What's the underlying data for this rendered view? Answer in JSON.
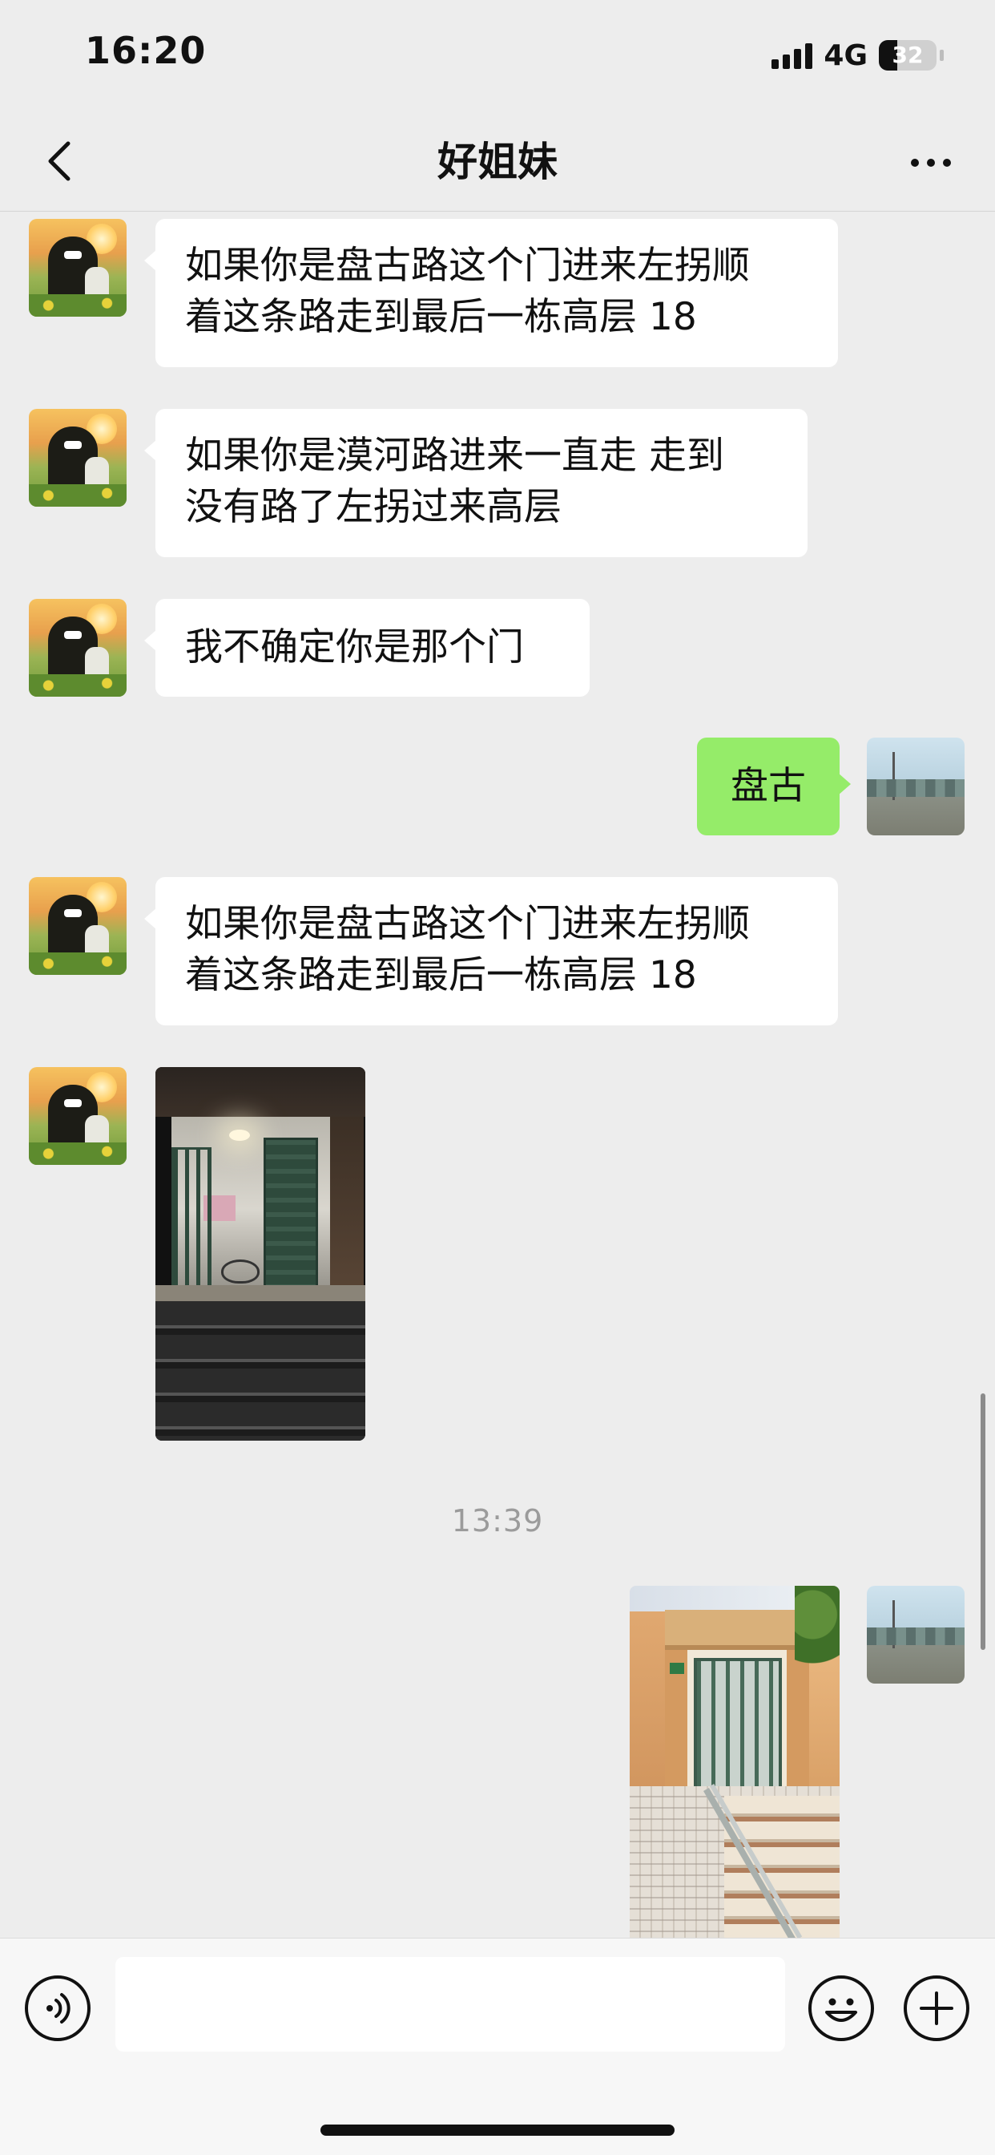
{
  "status_bar": {
    "time": "16:20",
    "network": "4G",
    "battery": "32",
    "battery_level": 0.32
  },
  "header": {
    "title": "好姐妹",
    "back_icon": "chevron-left-icon",
    "more_icon": "more-icon"
  },
  "messages": [
    {
      "side": "in",
      "type": "text",
      "lines": [
        "如果你是盘古路这个门进来左拐顺",
        "着这条路走到最后一栋高层 18"
      ]
    },
    {
      "side": "in",
      "type": "text",
      "lines": [
        "如果你是漠河路进来一直走 走到",
        "没有路了左拐过来高层"
      ]
    },
    {
      "side": "in",
      "type": "text",
      "lines": [
        "我不确定你是那个门"
      ]
    },
    {
      "side": "out",
      "type": "text",
      "lines": [
        "盘古"
      ]
    },
    {
      "side": "in",
      "type": "text",
      "lines": [
        "如果你是盘古路这个门进来左拐顺",
        "着这条路走到最后一栋高层 18"
      ]
    },
    {
      "side": "in",
      "type": "image"
    },
    {
      "type": "timestamp",
      "text": "13:39"
    },
    {
      "side": "out",
      "type": "image"
    }
  ],
  "input_bar": {
    "placeholder": "",
    "voice_icon": "voice-icon",
    "emoji_icon": "emoji-icon",
    "plus_icon": "plus-icon"
  }
}
